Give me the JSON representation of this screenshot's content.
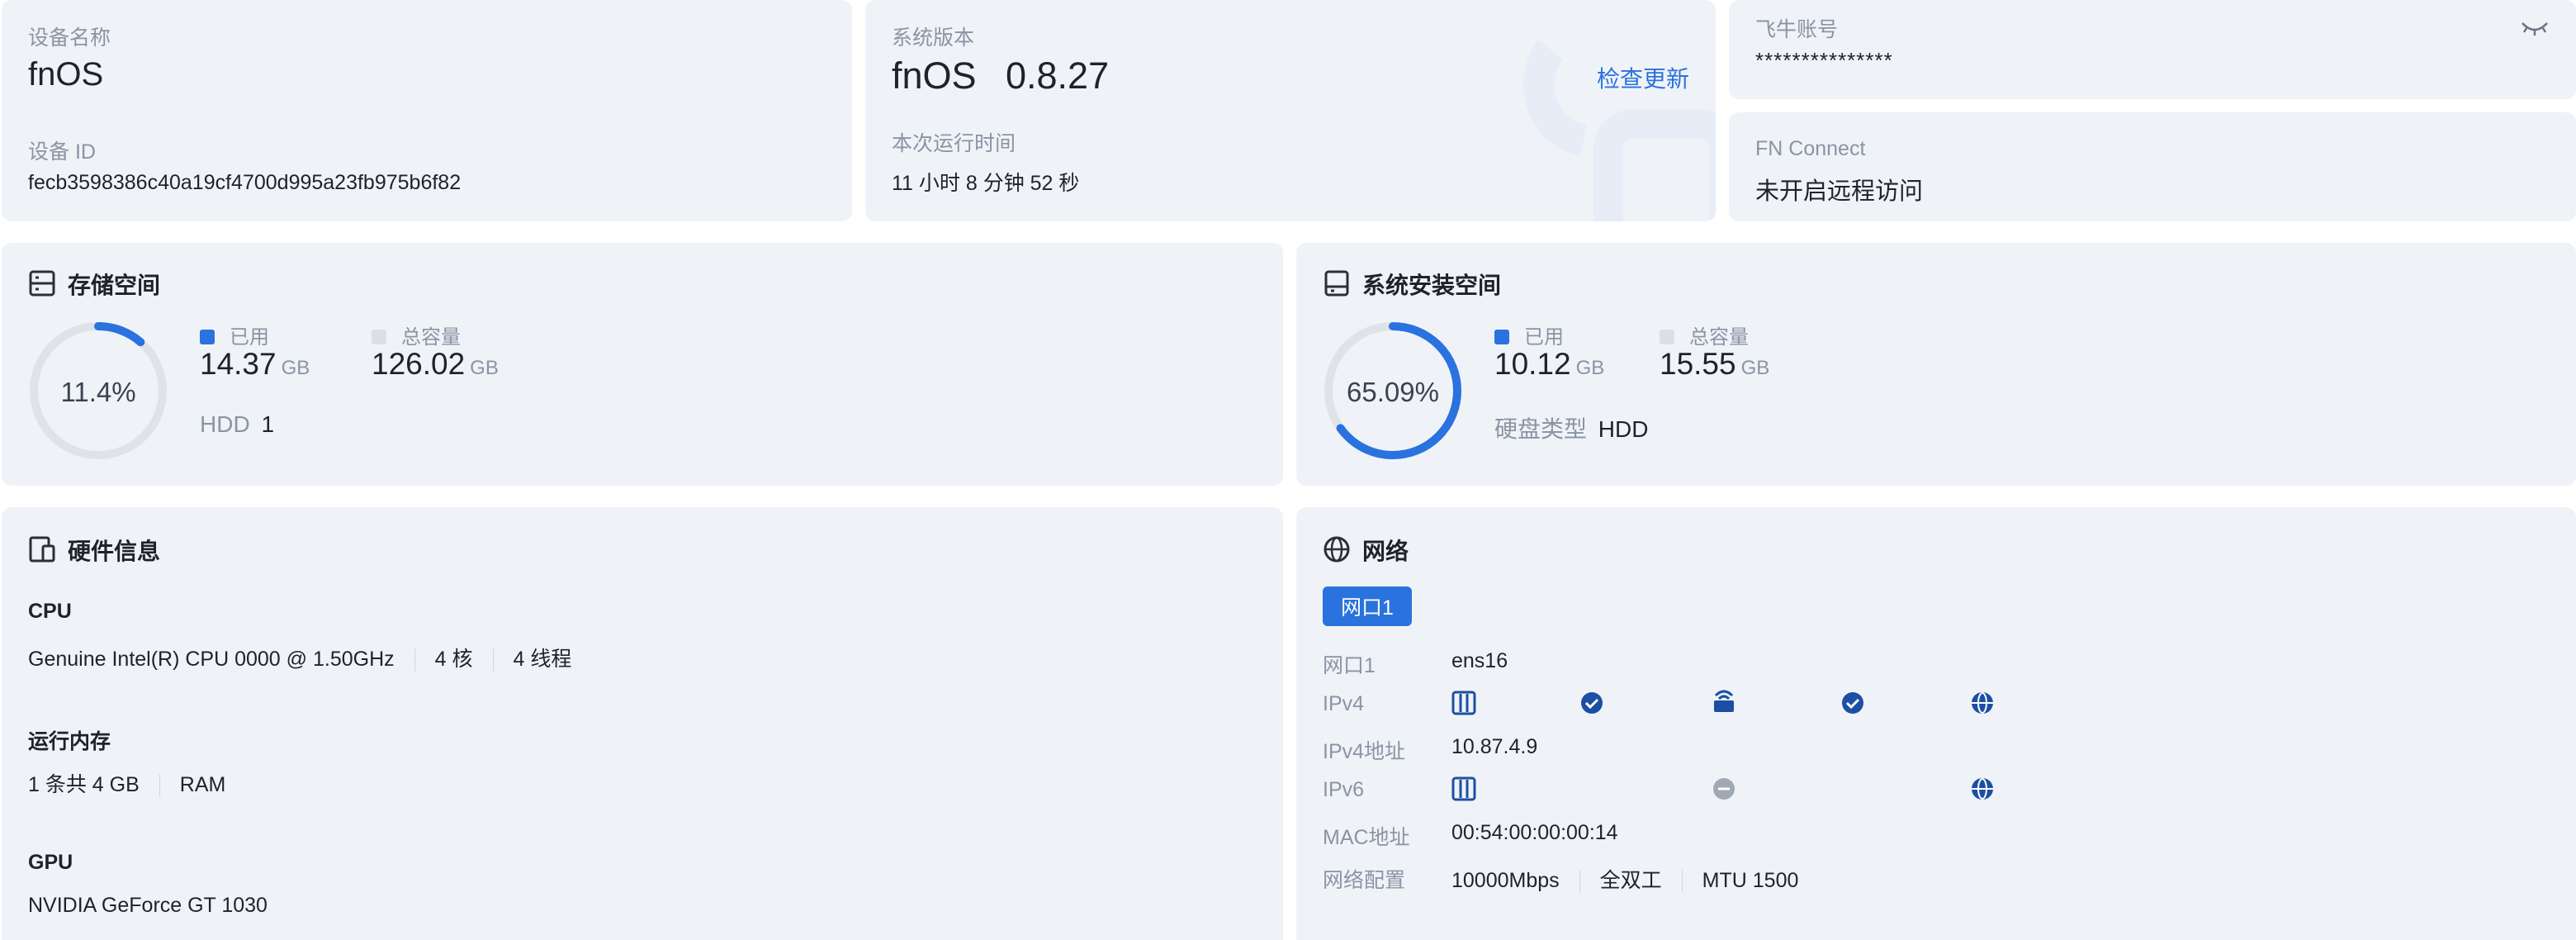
{
  "device": {
    "name_label": "设备名称",
    "name_value": "fnOS",
    "id_label": "设备 ID",
    "id_value": "fecb3598386c40a19cf4700d995a23fb975b6f82"
  },
  "system": {
    "version_label": "系统版本",
    "os_name": "fnOS",
    "version": "0.8.27",
    "check_update": "检查更新",
    "uptime_label": "本次运行时间",
    "uptime_value": "11 小时 8 分钟 52 秒"
  },
  "account": {
    "label": "飞牛账号",
    "value": "***************"
  },
  "fn_connect": {
    "label": "FN Connect",
    "value": "未开启远程访问"
  },
  "storage": {
    "title": "存储空间",
    "percent": "11.4%",
    "percent_fraction": 0.114,
    "used_label": "已用",
    "used_value": "14.37",
    "used_unit": "GB",
    "total_label": "总容量",
    "total_value": "126.02",
    "total_unit": "GB",
    "disk_type_label": "HDD",
    "disk_type_count": "1"
  },
  "system_storage": {
    "title": "系统安装空间",
    "percent": "65.09%",
    "percent_fraction": 0.6509,
    "used_label": "已用",
    "used_value": "10.12",
    "used_unit": "GB",
    "total_label": "总容量",
    "total_value": "15.55",
    "total_unit": "GB",
    "disk_type_label": "硬盘类型",
    "disk_type_value": "HDD"
  },
  "hardware": {
    "title": "硬件信息",
    "cpu_label": "CPU",
    "cpu_model": "Genuine Intel(R) CPU 0000 @ 1.50GHz",
    "cpu_cores": "4 核",
    "cpu_threads": "4 线程",
    "ram_label": "运行内存",
    "ram_sticks": "1 条共 4 GB",
    "ram_type": "RAM",
    "gpu_label": "GPU",
    "gpu_model": "NVIDIA GeForce GT 1030"
  },
  "network": {
    "title": "网络",
    "tab_label": "网口1",
    "rows": {
      "port_label": "网口1",
      "port_value": "ens16",
      "ipv4_label": "IPv4",
      "ipv4_addr_label": "IPv4地址",
      "ipv4_addr_value": "10.87.4.9",
      "ipv6_label": "IPv6",
      "mac_label": "MAC地址",
      "mac_value": "00:54:00:00:00:14",
      "config_label": "网络配置",
      "speed": "10000Mbps",
      "duplex": "全双工",
      "mtu": "MTU 1500"
    }
  },
  "colors": {
    "card_bg": "#eff3f8",
    "accent": "#2a72de",
    "dark_blue": "#1c4fa3",
    "ring_track": "#dfe3e8"
  }
}
